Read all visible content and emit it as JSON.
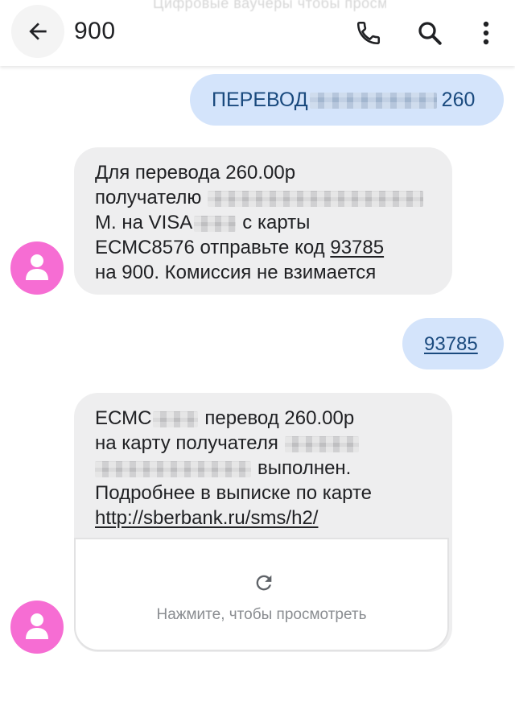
{
  "header": {
    "status_ghost": "Цифровые ваучеры чтобы просмотреть",
    "title": "900",
    "icons": {
      "back": "arrow-back-icon",
      "call": "phone-icon",
      "search": "search-icon",
      "more": "more-vert-icon"
    }
  },
  "colors": {
    "avatar": "#f66dd3",
    "outgoing_bubble": "#d4e4fb",
    "incoming_bubble": "#eeeeef",
    "outgoing_text": "#1a4a7e"
  },
  "messages": {
    "m1": {
      "direction": "outgoing",
      "prefix": "ПЕРЕВОД",
      "suffix": "260"
    },
    "m2": {
      "direction": "incoming",
      "line1": "Для перевода 260.00р",
      "line2_prefix": "получателю",
      "line3_prefix": "М. на VISA",
      "line3_suffix": "с карты",
      "line4_prefix": "ЕСМС8576 отправьте код",
      "line4_code": "93785",
      "line5": "на 900. Комиссия не взимается"
    },
    "m3": {
      "direction": "outgoing",
      "text": "93785"
    },
    "m4": {
      "direction": "incoming",
      "line1_prefix": "ЕСМС",
      "line1_suffix": "перевод 260.00р",
      "line2_prefix": "на карту получателя",
      "line3_suffix": "выполнен.",
      "line4": "Подробнее в выписке по карте",
      "link": "http://sberbank.ru/sms/h2/",
      "preview_label": "Нажмите, чтобы просмотреть",
      "preview_icon": "refresh-icon"
    }
  },
  "avatar_icon": "person-icon"
}
